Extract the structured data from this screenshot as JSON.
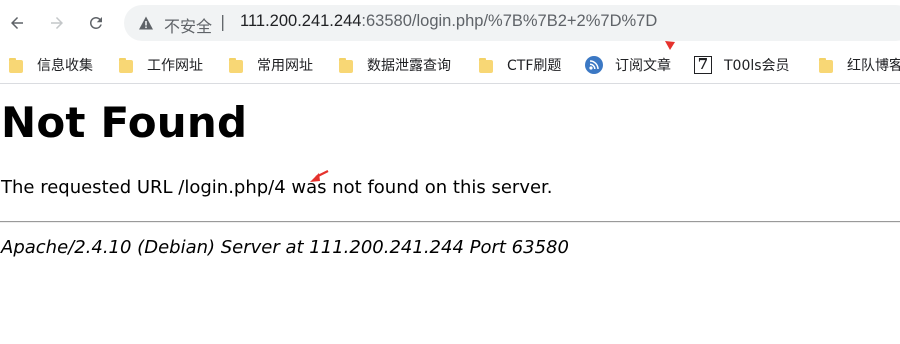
{
  "browser": {
    "address_bar": {
      "security_label": "不安全",
      "separator": "|",
      "url_host": "111.200.241.244",
      "url_rest": ":63580/login.php/%7B%7B2+2%7D%7D"
    }
  },
  "bookmarks": [
    {
      "label": "信息收集",
      "icon": "folder-icon"
    },
    {
      "label": "工作网址",
      "icon": "folder-icon"
    },
    {
      "label": "常用网址",
      "icon": "folder-icon"
    },
    {
      "label": "数据泄露查询",
      "icon": "folder-icon"
    },
    {
      "label": "CTF刷题",
      "icon": "folder-icon"
    },
    {
      "label": "订阅文章",
      "icon": "rss-icon"
    },
    {
      "label": "T00ls会员",
      "icon": "t00ls-icon"
    },
    {
      "label": "红队博客",
      "icon": "folder-icon"
    }
  ],
  "page": {
    "title": "Not Found",
    "message": "The requested URL /login.php/4 was not found on this server.",
    "footer": "Apache/2.4.10 (Debian) Server at 111.200.241.244 Port 63580"
  },
  "colors": {
    "annotation": "#e5322d",
    "folder": "#f8d775",
    "omnibox_bg": "#f1f3f4"
  }
}
